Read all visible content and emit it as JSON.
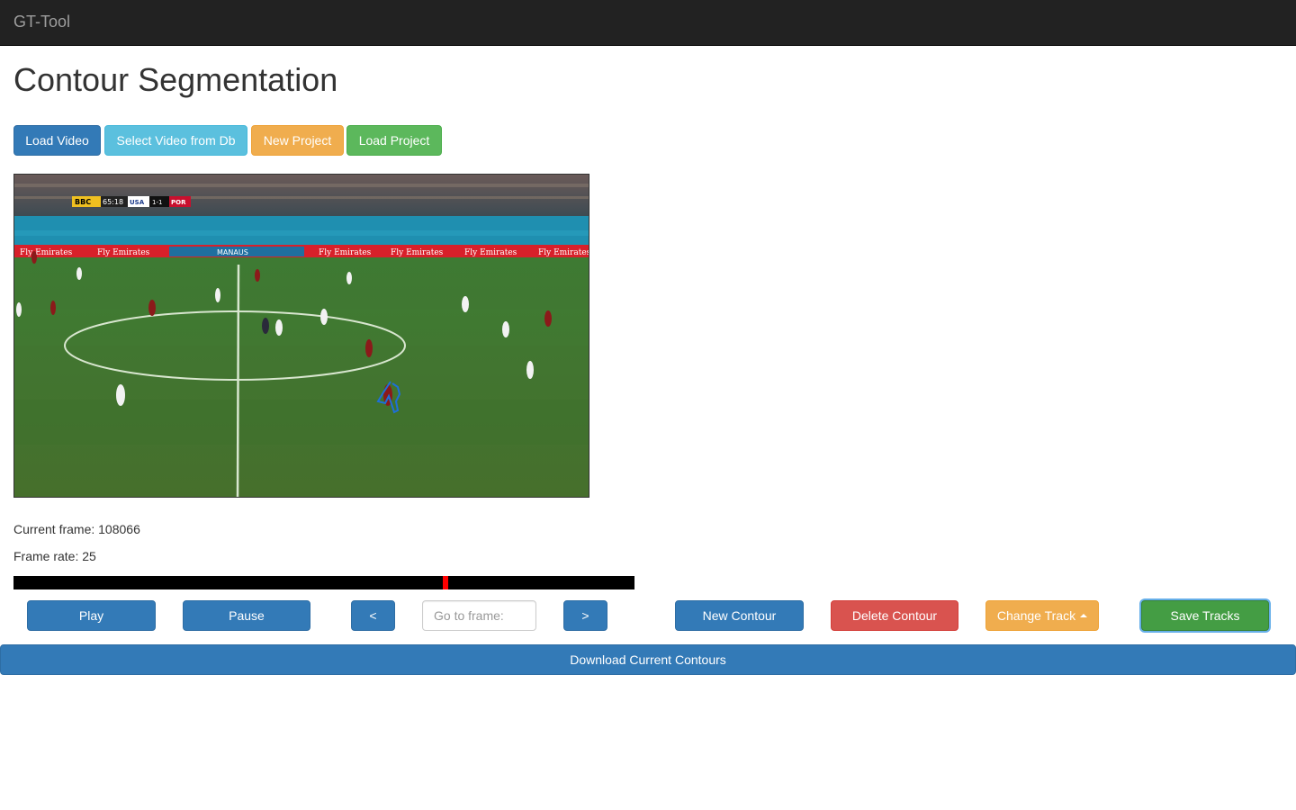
{
  "navbar": {
    "brand": "GT-Tool"
  },
  "page": {
    "title": "Contour Segmentation"
  },
  "toolbar": {
    "load_video": "Load Video",
    "select_video_db": "Select Video from Db",
    "new_project": "New Project",
    "load_project": "Load Project"
  },
  "video": {
    "scoreboard": {
      "broadcaster": "BBC",
      "time": "65:18",
      "home": "USA",
      "score": "1-1",
      "away": "POR"
    },
    "ad_text": "Fly Emirates",
    "venue_text": "MANAUS",
    "colors": {
      "pitch": "#3f7a2f",
      "ad_board": "#d8202a",
      "contour": "#1e6fd9"
    }
  },
  "info": {
    "current_frame_label": "Current frame: 108066",
    "frame_rate_label": "Frame rate: 25"
  },
  "timeline": {
    "progress": 0.697
  },
  "controls": {
    "play": "Play",
    "pause": "Pause",
    "prev": "<",
    "goto_placeholder": "Go to frame:",
    "next": ">",
    "new_contour": "New Contour",
    "delete_contour": "Delete Contour",
    "change_track": "Change Track",
    "save_tracks": "Save Tracks"
  },
  "download": {
    "label": "Download Current Contours"
  }
}
